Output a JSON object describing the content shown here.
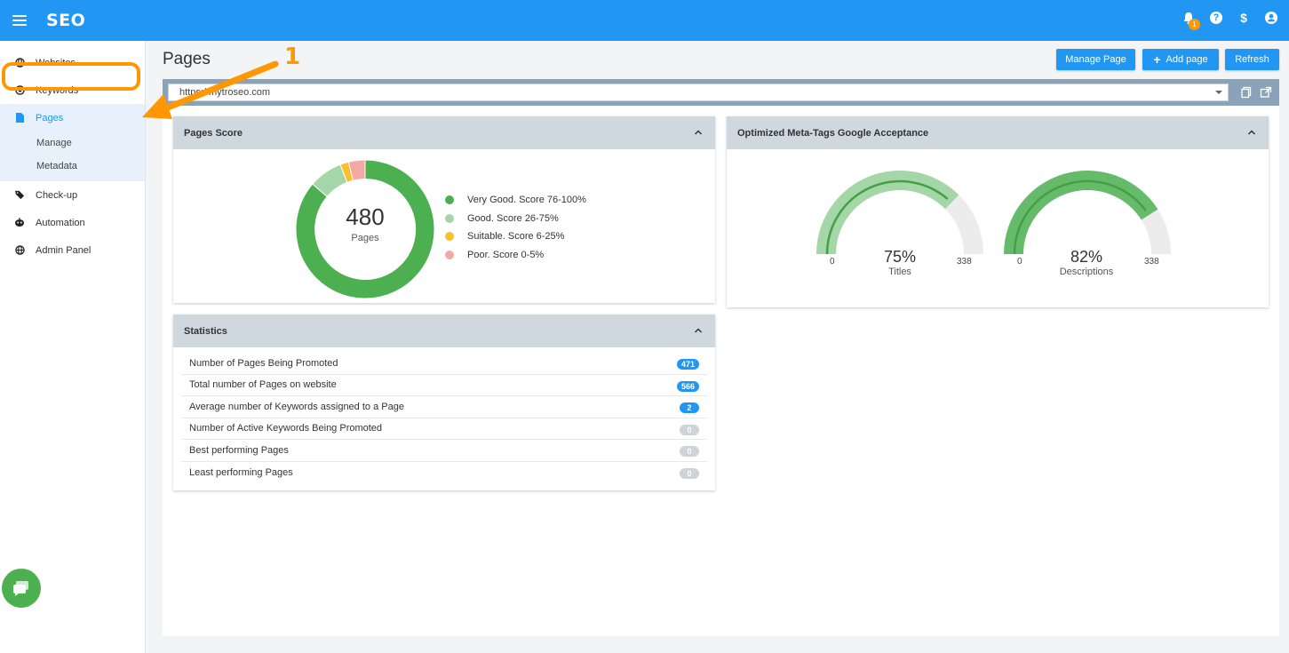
{
  "app": {
    "title": "SEO"
  },
  "topbar": {
    "notification_count": "1",
    "help_icon_glyph": "?",
    "billing_icon_glyph": "$",
    "icons": [
      "bell-icon",
      "help-icon",
      "dollar-icon",
      "user-icon"
    ]
  },
  "sidebar": {
    "items": [
      {
        "label": "Websites",
        "icon": "globe-icon"
      },
      {
        "label": "Keywords",
        "icon": "target-icon"
      },
      {
        "label": "Pages",
        "icon": "file-icon",
        "active": true
      },
      {
        "label": "Check-up",
        "icon": "tag-icon"
      },
      {
        "label": "Automation",
        "icon": "robot-icon"
      },
      {
        "label": "Admin Panel",
        "icon": "globe-icon"
      }
    ],
    "sub_items": [
      {
        "label": "Manage"
      },
      {
        "label": "Metadata"
      }
    ]
  },
  "annotation": {
    "number": "1",
    "color": "#ff9800"
  },
  "main": {
    "title": "Pages",
    "buttons": {
      "manage_page": "Manage Page",
      "add_page": "Add page",
      "refresh": "Refresh"
    },
    "url": {
      "value": "https://mytroseo.com"
    }
  },
  "pages_score": {
    "header": "Pages Score",
    "total": "480",
    "total_label": "Pages",
    "legend": [
      {
        "label": "Very Good. Score 76-100%",
        "color": "#4caf50"
      },
      {
        "label": "Good. Score 26-75%",
        "color": "#a5d6a7"
      },
      {
        "label": "Suitable. Score 6-25%",
        "color": "#fbc02d"
      },
      {
        "label": "Poor. Score 0-5%",
        "color": "#f4a9a4"
      }
    ]
  },
  "meta_tags": {
    "header": "Optimized Meta-Tags Google Acceptance",
    "gauges": [
      {
        "name": "Titles",
        "percent": "75%",
        "value": 75,
        "min": "0",
        "max": "338",
        "fill_color": "#a5d6a7",
        "line_color": "#43a047"
      },
      {
        "name": "Descriptions",
        "percent": "82%",
        "value": 82,
        "min": "0",
        "max": "338",
        "fill_color": "#66bb6a",
        "line_color": "#43a047"
      }
    ]
  },
  "statistics": {
    "header": "Statistics",
    "rows": [
      {
        "label": "Number of Pages Being Promoted",
        "value": "471"
      },
      {
        "label": "Total number of Pages on website",
        "value": "566"
      },
      {
        "label": "Average number of Keywords assigned to a Page",
        "value": "2"
      },
      {
        "label": "Number of Active Keywords Being Promoted",
        "value": "0"
      },
      {
        "label": "Best performing Pages",
        "value": "0"
      },
      {
        "label": "Least performing Pages",
        "value": "0"
      }
    ]
  },
  "colors": {
    "brand": "#2196f3",
    "accent_orange": "#ff9800",
    "chat": "#4caf50"
  }
}
